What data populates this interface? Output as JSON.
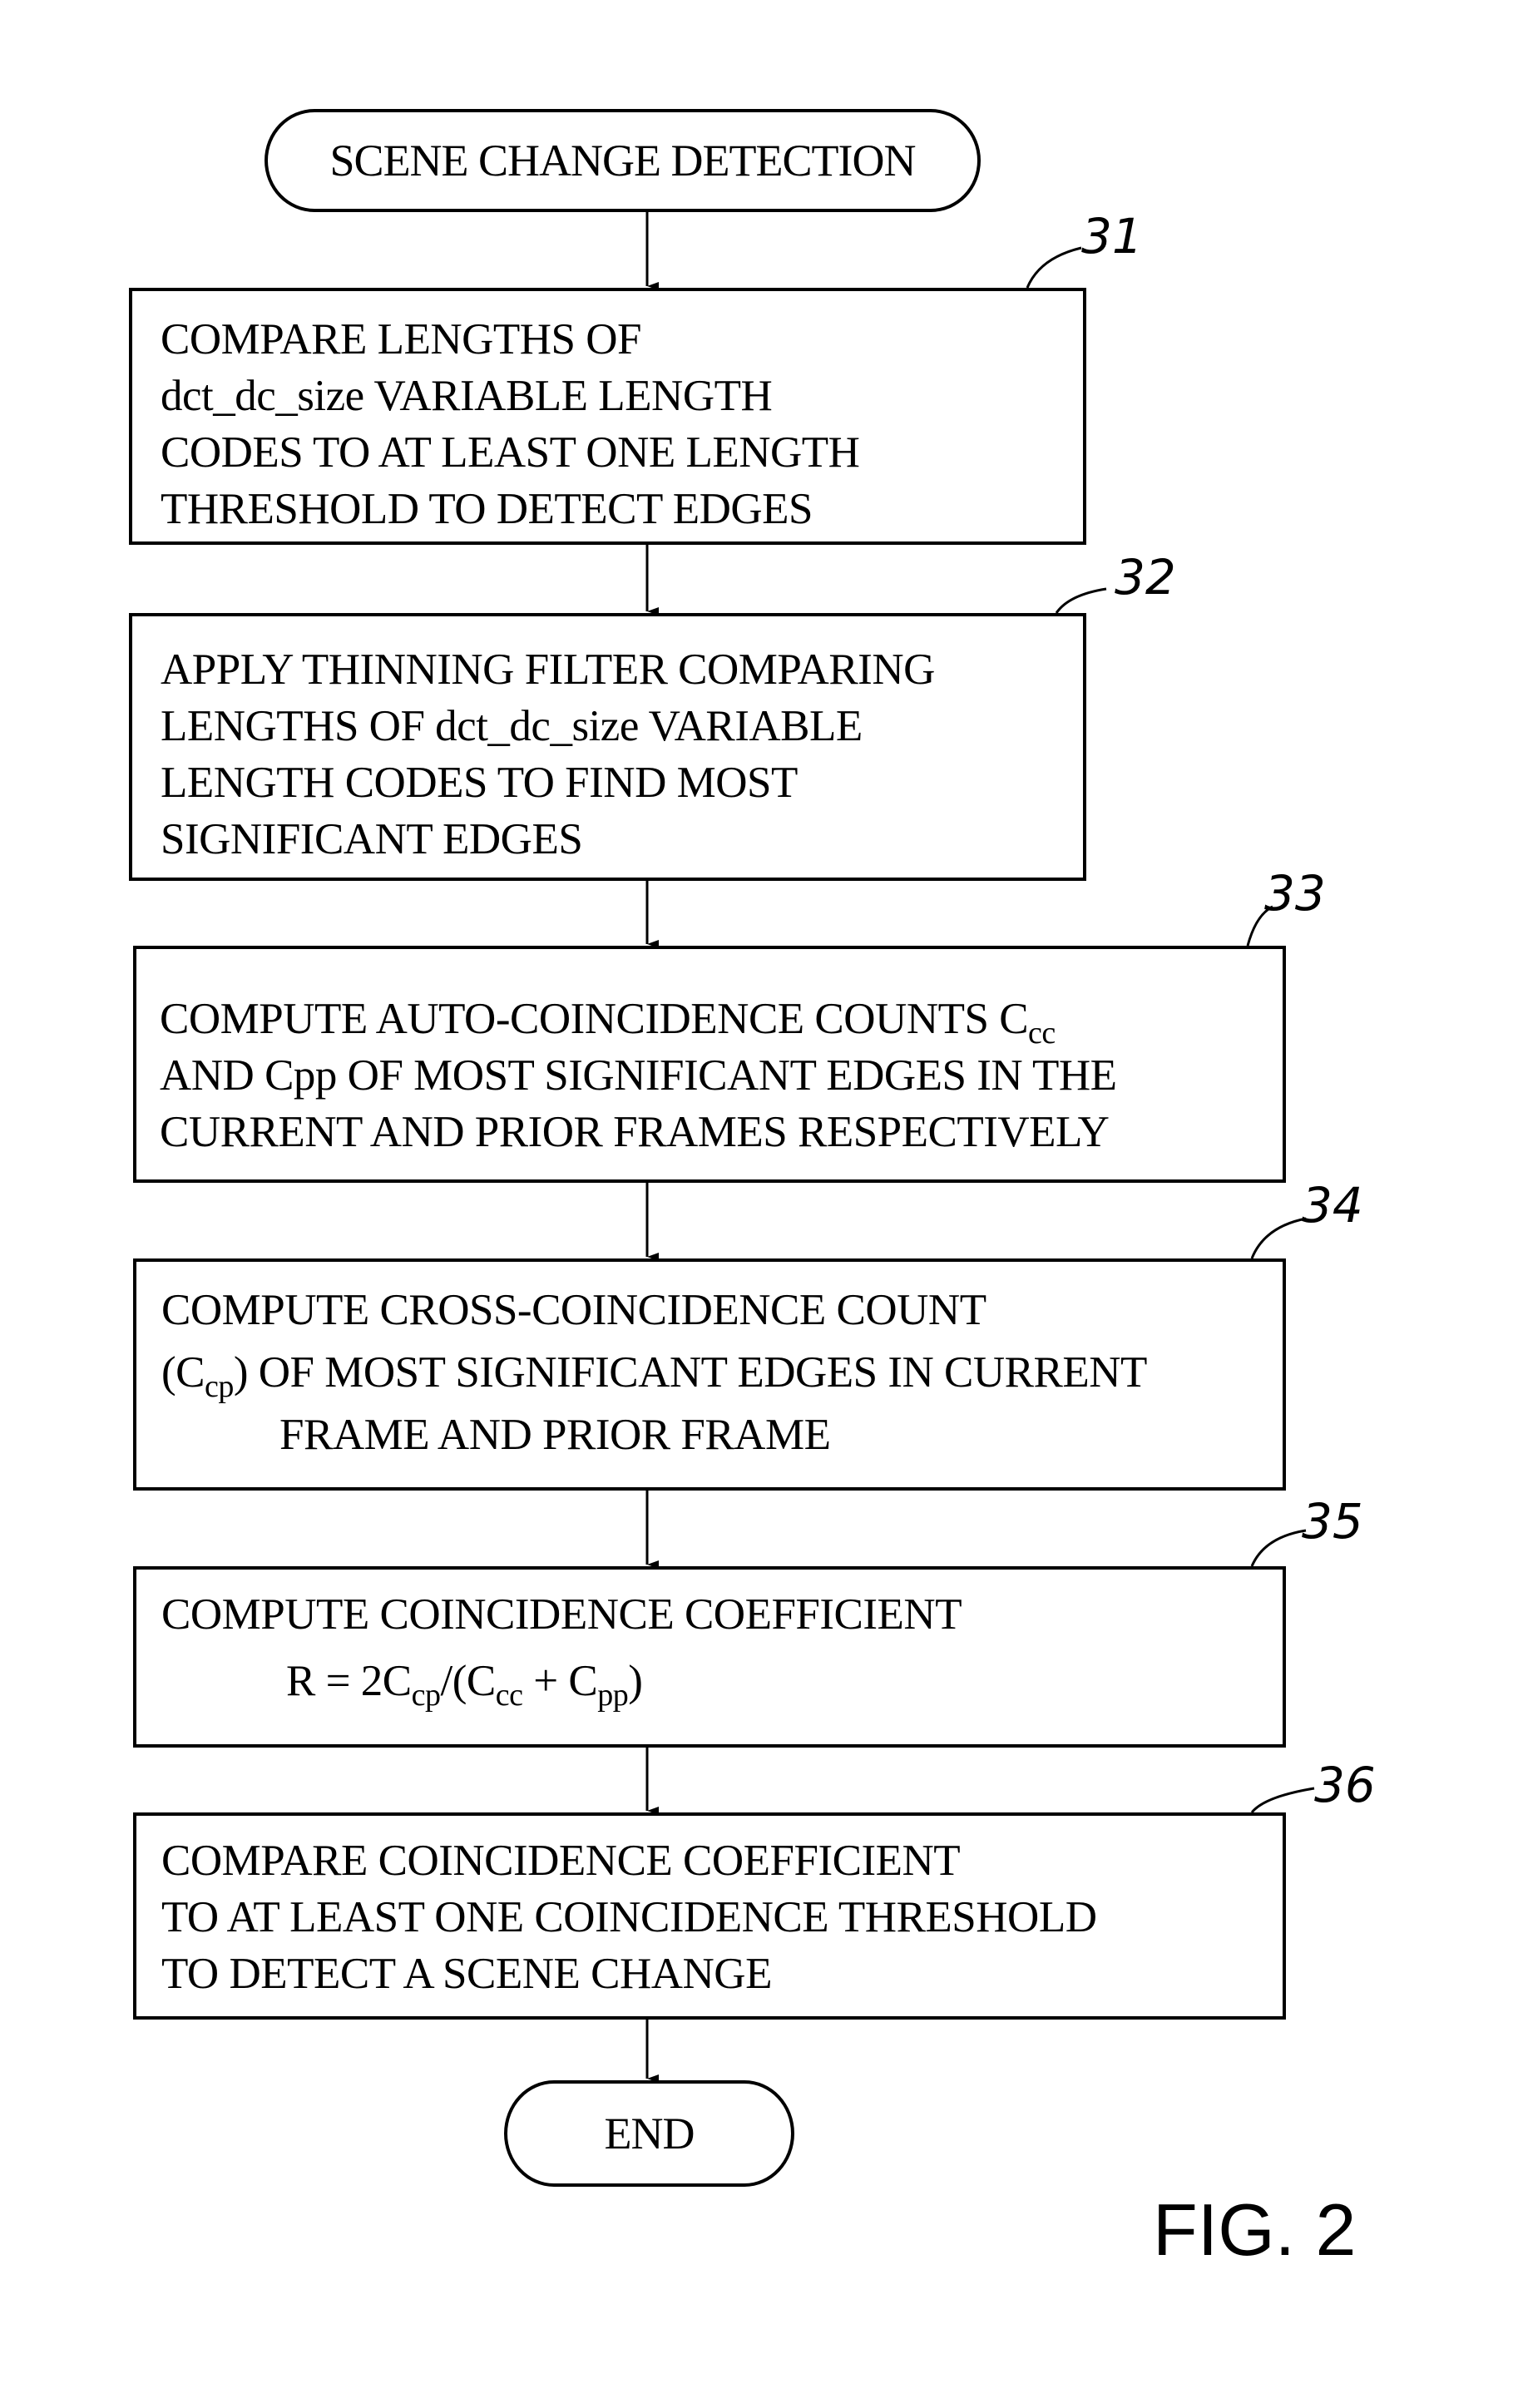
{
  "start": {
    "label": "SCENE CHANGE DETECTION"
  },
  "end": {
    "label": "END"
  },
  "steps": [
    {
      "ref": "31",
      "lines": [
        "COMPARE LENGTHS OF",
        "dct_dc_size VARIABLE LENGTH",
        "CODES TO AT LEAST ONE LENGTH",
        "THRESHOLD TO DETECT EDGES"
      ]
    },
    {
      "ref": "32",
      "lines": [
        "APPLY THINNING FILTER COMPARING",
        "LENGTHS OF dct_dc_size VARIABLE",
        "LENGTH CODES TO FIND MOST",
        "SIGNIFICANT EDGES"
      ]
    },
    {
      "ref": "33",
      "lines": [
        "COMPUTE AUTO-COINCIDENCE COUNTS C",
        "AND Cpp OF MOST SIGNIFICANT EDGES IN THE",
        "CURRENT AND PRIOR FRAMES RESPECTIVELY"
      ],
      "line1_sub": "cc"
    },
    {
      "ref": "34",
      "lines": [
        "COMPUTE CROSS-COINCIDENCE COUNT",
        "OF MOST SIGNIFICANT EDGES IN CURRENT",
        "FRAME AND PRIOR FRAME"
      ],
      "line2_prefix": "(C",
      "line2_sub": "cp",
      "line2_close": ")"
    },
    {
      "ref": "35",
      "lines": [
        "COMPUTE COINCIDENCE COEFFICIENT"
      ],
      "formula": {
        "a": "R = 2C",
        "a_sub": "cp",
        "b": "/(C",
        "b_sub": "cc",
        "c": " + C",
        "c_sub": "pp",
        "d": ")"
      }
    },
    {
      "ref": "36",
      "lines": [
        "COMPARE COINCIDENCE COEFFICIENT",
        "TO AT LEAST ONE COINCIDENCE THRESHOLD",
        "TO DETECT A SCENE CHANGE"
      ]
    }
  ],
  "figure_label": "FIG. 2"
}
